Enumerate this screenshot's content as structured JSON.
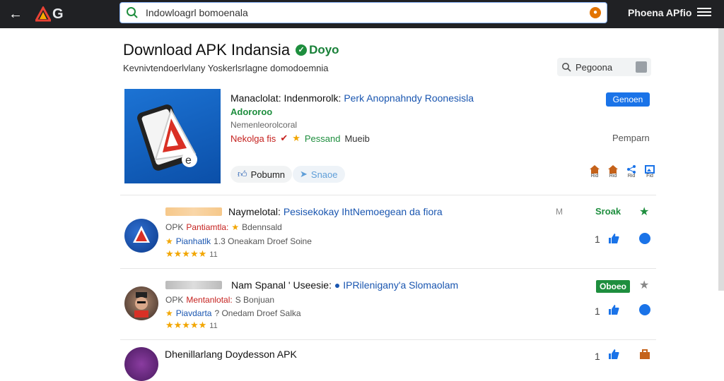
{
  "topbar": {
    "search_value": "Indowloagrl bomoenala",
    "brand": "Phoena APfio",
    "logo_letter": "G"
  },
  "header": {
    "title": "Download APK Indansia",
    "badge": "Doyo",
    "subtitle": "Kevnivtendoerlvlany  Yoskerlsrlagne domodoemnia",
    "filter_label": "Pegoona"
  },
  "featured": {
    "title_black": "Manaclolat: Indenmorolk:",
    "title_blue": "Perk Anopnahndy Roonesisla",
    "green_line": "Adororoo",
    "meta": "Nemenleorolcoral",
    "rating_red": "Nekolga fis",
    "rating_green": "Pessand",
    "rating_gray": "Mueib",
    "like_label": "Pobumn",
    "share_label": "Snaoe",
    "open_button": "Genoen",
    "right_label": "Pemparn",
    "mini_icons": [
      {
        "name": "home-icon",
        "label": "Rid",
        "color": "#c5621a"
      },
      {
        "name": "home-icon",
        "label": "Rid",
        "color": "#c5621a"
      },
      {
        "name": "share-icon",
        "label": "Rid",
        "color": "#1a73e8"
      },
      {
        "name": "image-icon",
        "label": "Fid",
        "color": "#1a73e8"
      }
    ]
  },
  "list": [
    {
      "title_black": "Naymelotal:",
      "title_blue": "Pesisekokay IhtNemoegean da fiora",
      "line1_gray": "OPK",
      "line1_red": "Pantiamtla:",
      "line1_rest": "Bdennsald",
      "line2_blue": "Pianhatlk",
      "line2_rest": "1.3 Oneakam  Droef Soine",
      "stars": "★★★★★",
      "star_count": "11",
      "version": "M",
      "tag": "Sroak",
      "num": "1",
      "avatar_color": "#1a56b0"
    },
    {
      "title_black": "Nam Spanal '  Useesie:",
      "title_blue": "IPRilenigany'a Slomaolam",
      "line1_gray": "OPK",
      "line1_red": "Mentanlotal:",
      "line1_rest": "S Bonjuan",
      "line2_blue": "Piavdarta",
      "line2_rest": "? Onedam  Droef Salka",
      "stars": "★★★★★",
      "star_count": "11",
      "version": "",
      "tag": "Oboeo",
      "num": "1",
      "avatar_color": "#5a4a40"
    },
    {
      "title_black": "Dhenillarlang Doydesson APK",
      "title_blue": "",
      "num": "1",
      "avatar_color": "#6a2a80"
    }
  ]
}
